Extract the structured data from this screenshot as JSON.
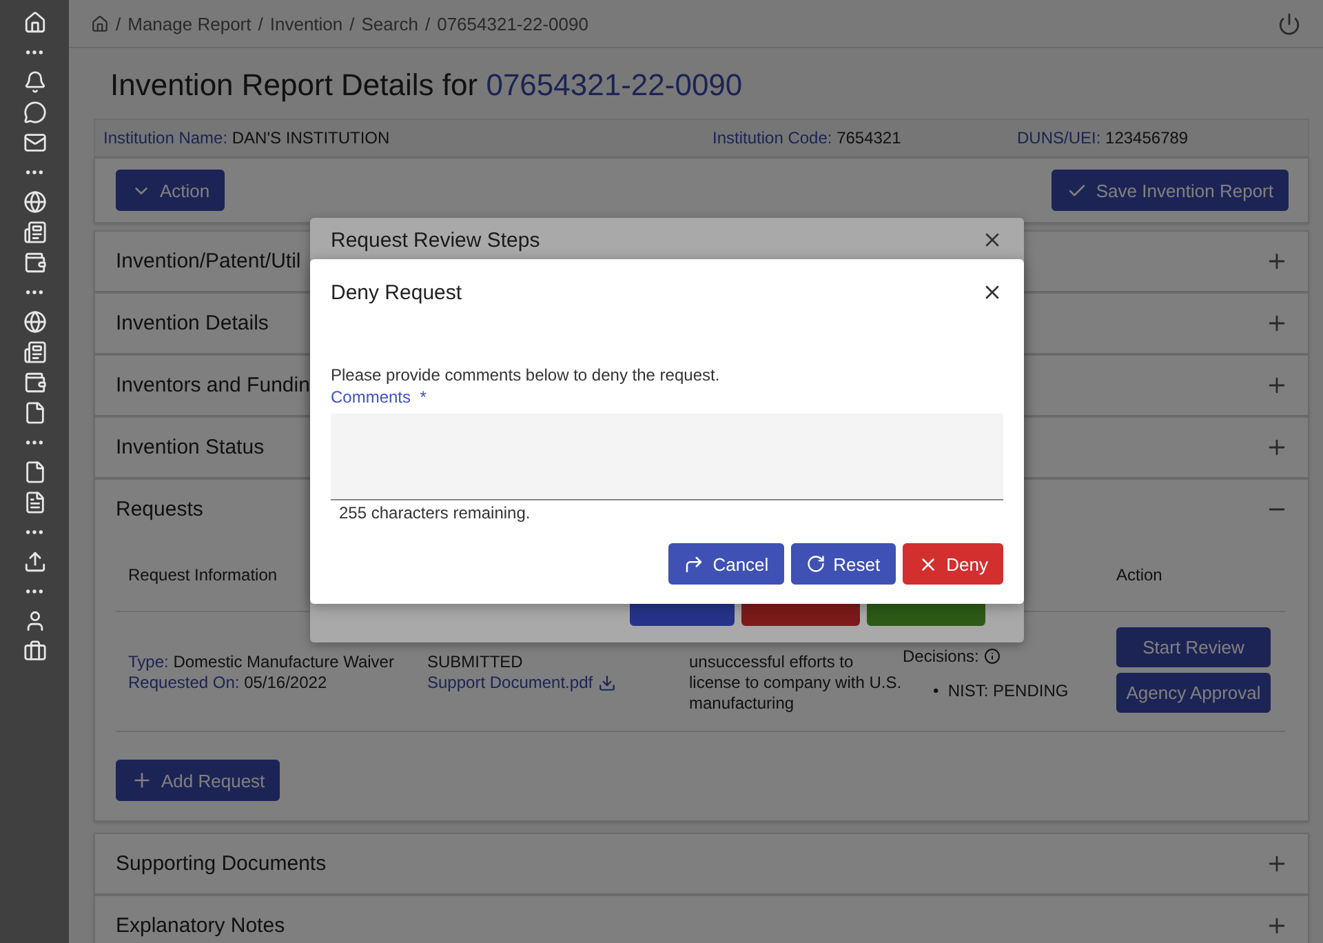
{
  "breadcrumb": {
    "separator": "/",
    "items": [
      "Manage Report",
      "Invention",
      "Search",
      "07654321-22-0090"
    ]
  },
  "page_title": {
    "text": "Invention Report Details for",
    "report_id": "07654321-22-0090"
  },
  "institution": [
    {
      "label": "Institution Name:",
      "value": "DAN'S INSTITUTION"
    },
    {
      "label": "Institution Code:",
      "value": "7654321"
    },
    {
      "label": "DUNS/UEI:",
      "value": "123456789"
    }
  ],
  "toolbar": {
    "action_button": "Action",
    "save_button": "Save Invention Report"
  },
  "sections": [
    {
      "title": "Invention/Patent/Util",
      "expanded": false
    },
    {
      "title": "Invention Details",
      "expanded": false
    },
    {
      "title": "Inventors and Fundin",
      "expanded": false
    },
    {
      "title": "Invention Status",
      "expanded": false
    },
    {
      "title": "Requests",
      "expanded": true,
      "table": {
        "columns": [
          "Request Information",
          "Action"
        ],
        "rows": [
          {
            "type_label": "Type:",
            "type": "Domestic Manufacture Waiver",
            "requested_label": "Requested On:",
            "requested": "05/16/2022",
            "status": "SUBMITTED",
            "document": "Support Document.pdf",
            "reason": "unsuccessful efforts to license to company with U.S. manufacturing",
            "decisions_label": "Decisions:",
            "bullet": "•",
            "decisions": [
              "NIST: PENDING"
            ],
            "actions": [
              "Start Review",
              "Agency Approval"
            ]
          }
        ]
      },
      "add_button": "Add Request"
    },
    {
      "title": "Supporting Documents",
      "expanded": false
    },
    {
      "title": "Explanatory Notes",
      "expanded": false
    }
  ],
  "back_dialog": {
    "title": "Request Review Steps",
    "buttons": [
      {
        "kind": "cancel"
      },
      {
        "kind": "deny"
      },
      {
        "kind": "approve"
      }
    ]
  },
  "dialog": {
    "title": "Deny Request",
    "message": "Please provide comments below to deny the request.",
    "field": {
      "label": "Comments",
      "required_mark": "*"
    },
    "counter": "255 characters remaining.",
    "buttons": [
      {
        "label": "Cancel",
        "kind": "cancel"
      },
      {
        "label": "Reset",
        "kind": "reset"
      },
      {
        "label": "Deny",
        "kind": "deny"
      }
    ]
  }
}
